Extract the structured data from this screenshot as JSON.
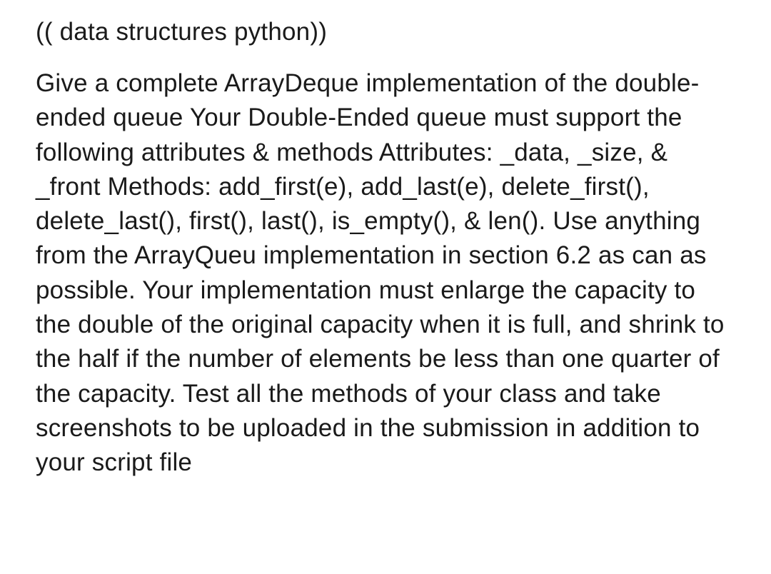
{
  "heading": "(( data structures python))",
  "body": "Give a complete ArrayDeque implementation of the double-ended queue Your Double-Ended queue must support the following attributes & methods Attributes: _data, _size, & _front Methods: add_first(e), add_last(e), delete_first(), delete_last(), first(), last(), is_empty(), & len(). Use anything from the ArrayQueu implementation in section 6.2 as can as possible. Your implementation must enlarge the capacity to the double of the original capacity when it is full, and shrink to the half if the number of elements be less than one quarter of the capacity. Test all the methods of your class and take screenshots to be uploaded in the submission in addition to your script file"
}
